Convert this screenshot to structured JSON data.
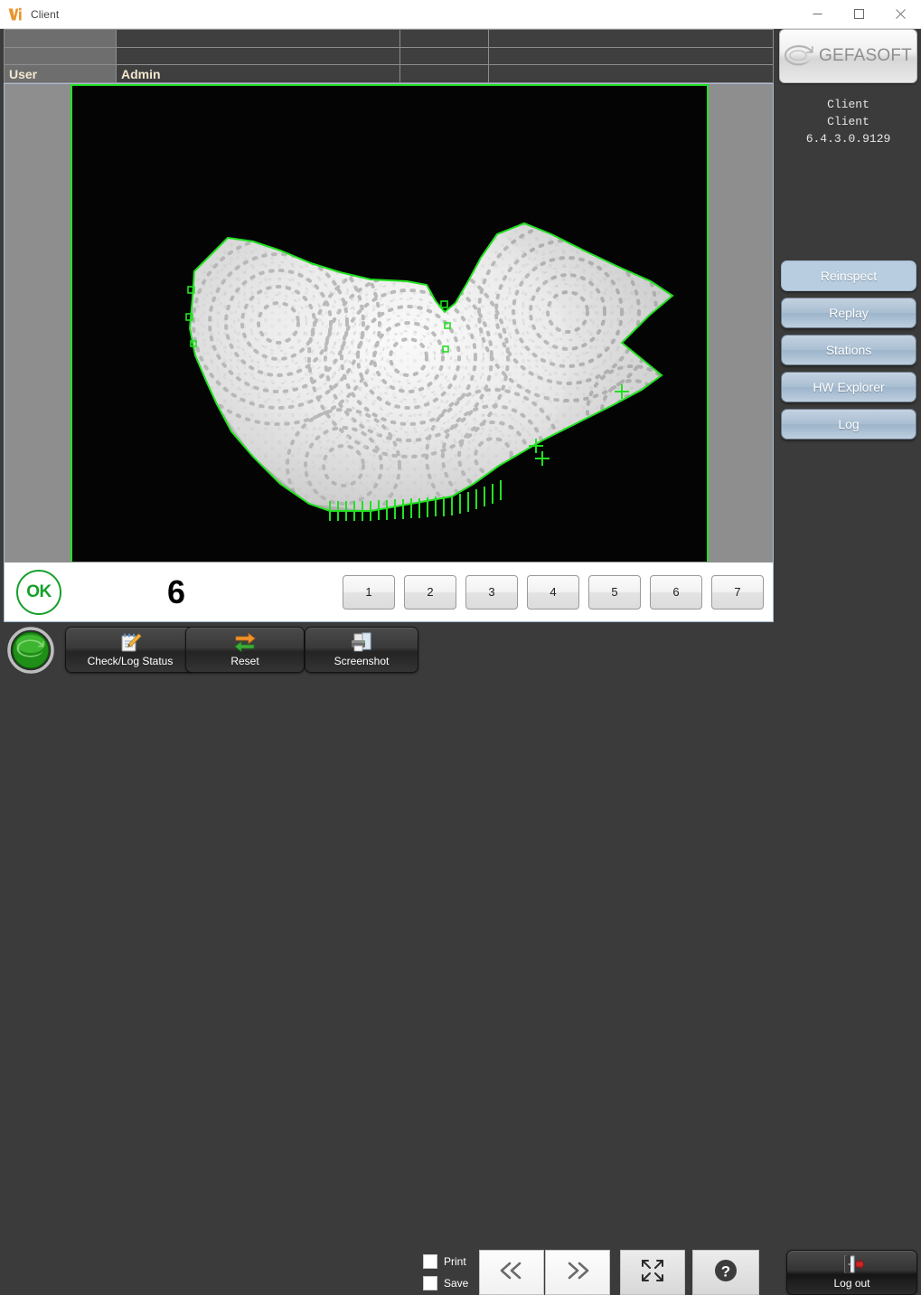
{
  "window": {
    "title": "Client",
    "icon": "app-logo-icon",
    "minimize_label": "—",
    "maximize_label": "□",
    "close_label": "✕"
  },
  "info_table": {
    "rows": [
      {
        "key": "",
        "value": "",
        "col3": "",
        "col4": ""
      },
      {
        "key": "",
        "value": "",
        "col3": "",
        "col4": ""
      },
      {
        "key": "User",
        "value": "Admin",
        "col3": "",
        "col4": ""
      }
    ]
  },
  "branding": {
    "logo_text": "GEFASOFT",
    "logo_icon": "circular-arrow-icon"
  },
  "version_panel": {
    "line1": "Client",
    "line2": "Client",
    "line3": "6.4.3.0.9129"
  },
  "side_buttons": [
    {
      "label": "Reinspect",
      "state": "active"
    },
    {
      "label": "Replay",
      "state": "normal"
    },
    {
      "label": "Stations",
      "state": "normal"
    },
    {
      "label": "HW Explorer",
      "state": "normal"
    },
    {
      "label": "Log",
      "state": "normal"
    }
  ],
  "viewer": {
    "background_color": "#000000",
    "frame_color": "#22e122",
    "contour_color": "#22e122",
    "panel_color": "#8e8e8e",
    "subject": "embossed-textured-part-inspection"
  },
  "result_bar": {
    "status_text": "OK",
    "status_color": "#16a02b",
    "count": "6",
    "number_buttons": [
      "1",
      "2",
      "3",
      "4",
      "5",
      "6",
      "7"
    ]
  },
  "toolbar": {
    "status_orb": "green-status-orb",
    "buttons": [
      {
        "label": "Check/Log Status",
        "icon": "notepad-pencil-icon"
      },
      {
        "label": "Reset",
        "icon": "refresh-arrows-icon"
      },
      {
        "label": "Screenshot",
        "icon": "printer-icon"
      }
    ],
    "checkboxes": [
      {
        "label": "Print",
        "checked": false
      },
      {
        "label": "Save",
        "checked": false
      }
    ],
    "nav": [
      {
        "label": "«",
        "icon": "chevron-double-left-icon"
      },
      {
        "label": "»",
        "icon": "chevron-double-right-icon"
      }
    ],
    "fullscreen_icon": "expand-arrows-icon",
    "help_icon": "question-mark-icon",
    "logout": {
      "label": "Log out",
      "icon": "door-exit-icon"
    }
  }
}
